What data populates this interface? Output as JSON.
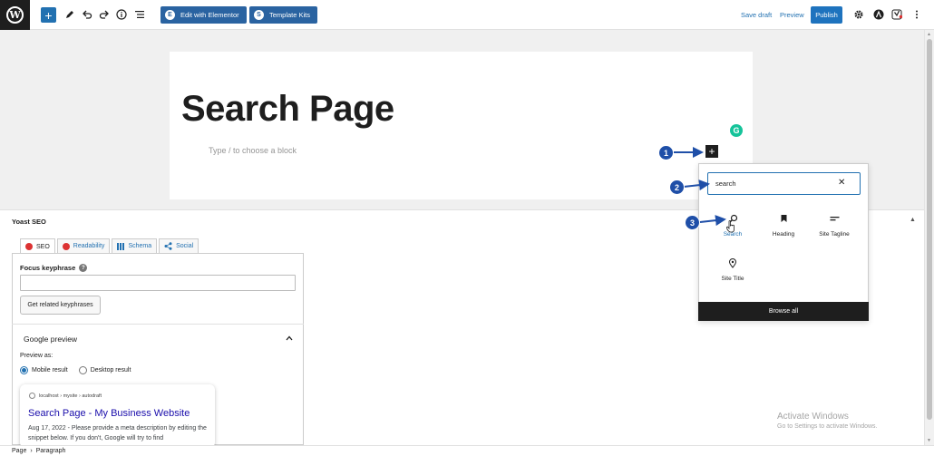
{
  "toolbar": {
    "edit_elementor": "Edit with Elementor",
    "template_kits": "Template Kits",
    "save_draft": "Save draft",
    "preview": "Preview",
    "publish": "Publish"
  },
  "editor": {
    "title": "Search Page",
    "placeholder": "Type / to choose a block"
  },
  "inserter": {
    "search_value": "search",
    "blocks": [
      {
        "label": "Search",
        "icon": "search-icon"
      },
      {
        "label": "Heading",
        "icon": "bookmark-icon"
      },
      {
        "label": "Site Tagline",
        "icon": "tagline-icon"
      },
      {
        "label": "Site Title",
        "icon": "map-pin-icon"
      }
    ],
    "browse_all": "Browse all"
  },
  "annotations": [
    "1",
    "2",
    "3"
  ],
  "yoast": {
    "title": "Yoast SEO",
    "tabs": [
      "SEO",
      "Readability",
      "Schema",
      "Social"
    ],
    "focus_label": "Focus keyphrase",
    "related_button": "Get related keyphrases",
    "google_preview": "Google preview",
    "preview_as": "Preview as:",
    "mobile": "Mobile result",
    "desktop": "Desktop result",
    "card": {
      "url": "localhost › mysite › autodraft",
      "title": "Search Page - My Business Website",
      "date": "Aug 17, 2022",
      "desc": "Please provide a meta description by editing the snippet below. If you don't, Google will try to find"
    }
  },
  "breadcrumb": {
    "page": "Page",
    "sep": "›",
    "block": "Paragraph"
  },
  "watermark": {
    "line1": "Activate Windows",
    "line2": "Go to Settings to activate Windows."
  },
  "colors": {
    "accent": "#2271b1",
    "annotation": "#1f4fa8",
    "yoast_red": "#dc3232"
  }
}
